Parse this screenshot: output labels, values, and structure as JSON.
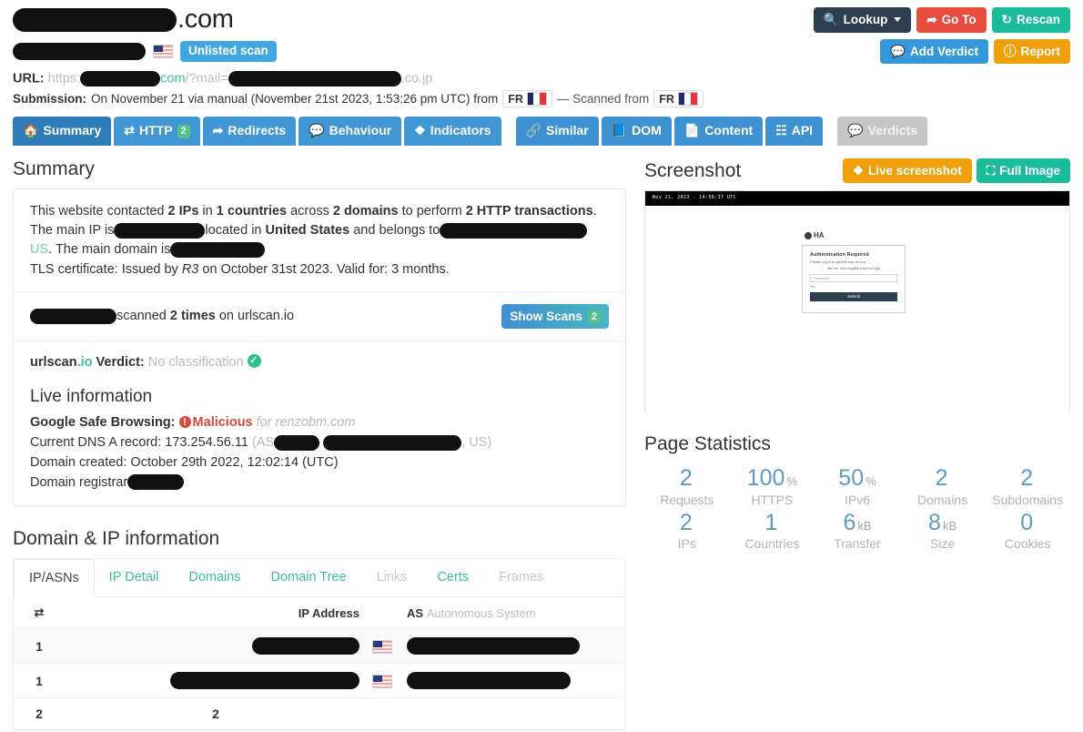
{
  "header": {
    "domain_suffix": ".com",
    "badge_unlisted": "Unlisted scan",
    "url_label": "URL:",
    "url_scheme": "https:",
    "url_mid": "com",
    "url_query": "/?mail=",
    "url_tail": ".co.jp",
    "submission_label": "Submission:",
    "submission_text": "On November 21 via manual (November 21st 2023, 1:53:26 pm UTC) from",
    "submission_country": "FR",
    "scanned_from_text": "— Scanned from",
    "scanned_country": "FR"
  },
  "actions": {
    "lookup": "Lookup",
    "goto": "Go To",
    "rescan": "Rescan",
    "add_verdict": "Add Verdict",
    "report": "Report"
  },
  "tabs": [
    {
      "label": "Summary",
      "icon": "home-icon",
      "state": "active"
    },
    {
      "label": "HTTP",
      "icon": "transfer-icon",
      "count": "2",
      "state": "normal"
    },
    {
      "label": "Redirects",
      "icon": "arrow-icon",
      "state": "normal"
    },
    {
      "label": "Behaviour",
      "icon": "comment-icon",
      "state": "normal"
    },
    {
      "label": "Indicators",
      "icon": "diamond-icon",
      "state": "normal"
    },
    {
      "label": "Similar",
      "icon": "link-icon",
      "state": "group2"
    },
    {
      "label": "DOM",
      "icon": "book-icon",
      "state": "group2"
    },
    {
      "label": "Content",
      "icon": "file-icon",
      "state": "group2"
    },
    {
      "label": "API",
      "icon": "qr-icon",
      "state": "group2"
    },
    {
      "label": "Verdicts",
      "icon": "comment-icon",
      "state": "disabled"
    }
  ],
  "summary": {
    "heading": "Summary",
    "line1_a": "This website contacted ",
    "line1_ips": "2 IPs",
    "line1_b": " in ",
    "line1_countries": "1 countries",
    "line1_c": " across ",
    "line1_domains": "2 domains",
    "line1_d": " to perform ",
    "line1_tx": "2 HTTP transactions",
    "line1_e": ".",
    "line2_a": "The main IP is",
    "line2_b": "located in ",
    "line2_country": "United States",
    "line2_c": " and belongs to",
    "line3_a": "US",
    "line3_b": ". The main domain is",
    "line4": "TLS certificate: Issued by ",
    "line4_issuer": "R3",
    "line4_b": " on October 31st 2023. Valid for: 3 months.",
    "scans_a": "scanned ",
    "scans_b": "2 times",
    "scans_c": " on urlscan.io",
    "show_scans": "Show Scans",
    "show_scans_count": "2",
    "verdict_brand": "urlscan",
    "verdict_brand_io": ".io",
    "verdict_label": " Verdict: ",
    "verdict_value": "No classification"
  },
  "live": {
    "heading": "Live information",
    "gsb_label": "Google Safe Browsing:",
    "gsb_value": "Malicious",
    "gsb_for": "for renzobm.com",
    "dns_label": "Current DNS A record:",
    "dns_value": "173.254.56.11",
    "dns_paren_open": "(AS",
    "dns_paren_close": ", US)",
    "created_label": "Domain created:",
    "created_value": "October 29th 2022, 12:02:14 (UTC)",
    "registrar_label": "Domain registrar"
  },
  "domain_ip": {
    "heading": "Domain & IP information",
    "subtabs": [
      {
        "label": "IP/ASNs",
        "state": "active"
      },
      {
        "label": "IP Detail",
        "state": "normal"
      },
      {
        "label": "Domains",
        "state": "normal"
      },
      {
        "label": "Domain Tree",
        "state": "normal"
      },
      {
        "label": "Links",
        "state": "disabled"
      },
      {
        "label": "Certs",
        "state": "normal"
      },
      {
        "label": "Frames",
        "state": "disabled"
      }
    ],
    "columns": {
      "sort": "⇄",
      "ip": "IP Address",
      "as": "AS",
      "as_sub": "Autonomous System"
    },
    "rows": [
      {
        "count": "1",
        "ip": "",
        "country": "US",
        "as": ""
      },
      {
        "count": "1",
        "ip": "",
        "country": "US",
        "as": ""
      }
    ],
    "totals": {
      "count": "2",
      "ip": "2"
    }
  },
  "screenshot": {
    "heading": "Screenshot",
    "live_button": "Live screenshot",
    "full_button": "Full Image",
    "bar_text": "Nov 21, 2023 - 14:58:37 UTC",
    "page_logo": "HA",
    "dialog_title": "Authentication Required",
    "dialog_text1": "Please log in to get the rest of your …",
    "dialog_text2": "Ide me, buit mqdjtfjno tafl es srjjn",
    "dialog_input_placeholder": "Password",
    "dialog_label": "Pw",
    "dialog_button": "Submit"
  },
  "page_statistics": {
    "heading": "Page Statistics",
    "items": [
      {
        "value": "2",
        "unit": "",
        "label": "Requests"
      },
      {
        "value": "100",
        "unit": "%",
        "label": "HTTPS"
      },
      {
        "value": "50",
        "unit": "%",
        "label": "IPv6"
      },
      {
        "value": "2",
        "unit": "",
        "label": "Domains"
      },
      {
        "value": "2",
        "unit": "",
        "label": "Subdomains"
      },
      {
        "value": "2",
        "unit": "",
        "label": "IPs"
      },
      {
        "value": "1",
        "unit": "",
        "label": "Countries"
      },
      {
        "value": "6",
        "unit": "kB",
        "label": "Transfer"
      },
      {
        "value": "8",
        "unit": "kB",
        "label": "Size"
      },
      {
        "value": "0",
        "unit": "",
        "label": "Cookies"
      }
    ]
  },
  "colors": {
    "tab_blue": "#4196d4",
    "tab_active": "#2e7cb8",
    "teal": "#3dbd9e",
    "danger": "#d94a3d",
    "orange": "#efa00b",
    "dark": "#2c3e50",
    "stat_blue": "#5b9bc4"
  }
}
